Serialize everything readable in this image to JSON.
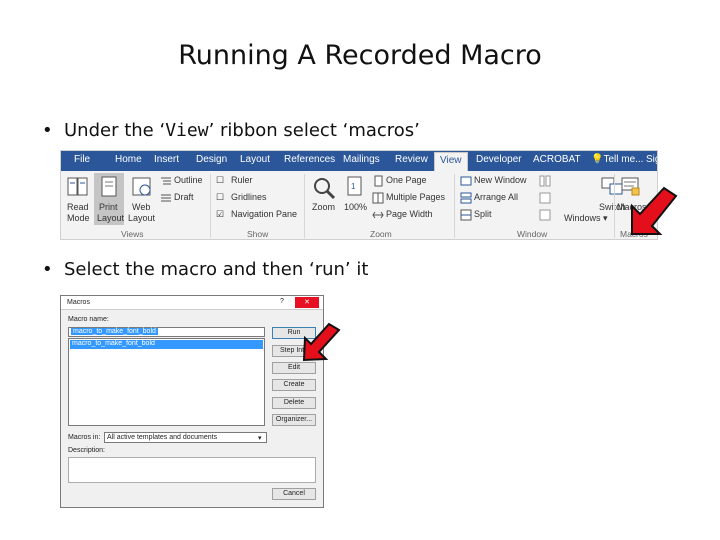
{
  "slide": {
    "title": "Running A Recorded Macro",
    "bullet1": {
      "prefix": "Under the ‘",
      "code": "View",
      "suffix": "’ ribbon select ‘macros’"
    },
    "bullet2": "Select the macro and then ‘run’ it"
  },
  "ribbon": {
    "tabs": [
      "File",
      "Home",
      "Insert",
      "Design",
      "Layout",
      "References",
      "Mailings",
      "Review",
      "View",
      "Developer",
      "ACROBAT",
      "Tell me...",
      "Sig"
    ],
    "active_tab": "View",
    "views": {
      "read_mode": [
        "Read",
        "Mode"
      ],
      "print_layout": [
        "Print",
        "Layout"
      ],
      "web_layout": [
        "Web",
        "Layout"
      ],
      "outline": "Outline",
      "draft": "Draft",
      "group": "Views"
    },
    "show": {
      "ruler": "Ruler",
      "gridlines": "Gridlines",
      "navigation_pane": "Navigation Pane",
      "group": "Show"
    },
    "zoom": {
      "zoom": "Zoom",
      "percent": "100%",
      "one_page": "One Page",
      "multiple_pages": "Multiple Pages",
      "page_width": "Page Width",
      "group": "Zoom"
    },
    "window": {
      "new_window": "New Window",
      "arrange_all": "Arrange All",
      "split": "Split",
      "switch": [
        "Switch",
        "Windows ▾"
      ],
      "group": "Window"
    },
    "macros": {
      "label": "Macros",
      "group": "Macros"
    },
    "colors": {
      "tab_bar": "#2b579a",
      "arrow": "#e3101b"
    }
  },
  "dialog": {
    "title": "Macros",
    "help": "?",
    "close": "✕",
    "macro_name_label": "Macro name:",
    "macro_name_value": "macro_to_make_font_bold",
    "list_items": [
      "macro_to_make_font_bold"
    ],
    "buttons": {
      "run": "Run",
      "step_into": "Step Into",
      "edit": "Edit",
      "create": "Create",
      "delete": "Delete",
      "organizer": "Organizer...",
      "cancel": "Cancel"
    },
    "macros_in_label": "Macros in:",
    "macros_in_value": "All active templates and documents",
    "description_label": "Description:"
  }
}
